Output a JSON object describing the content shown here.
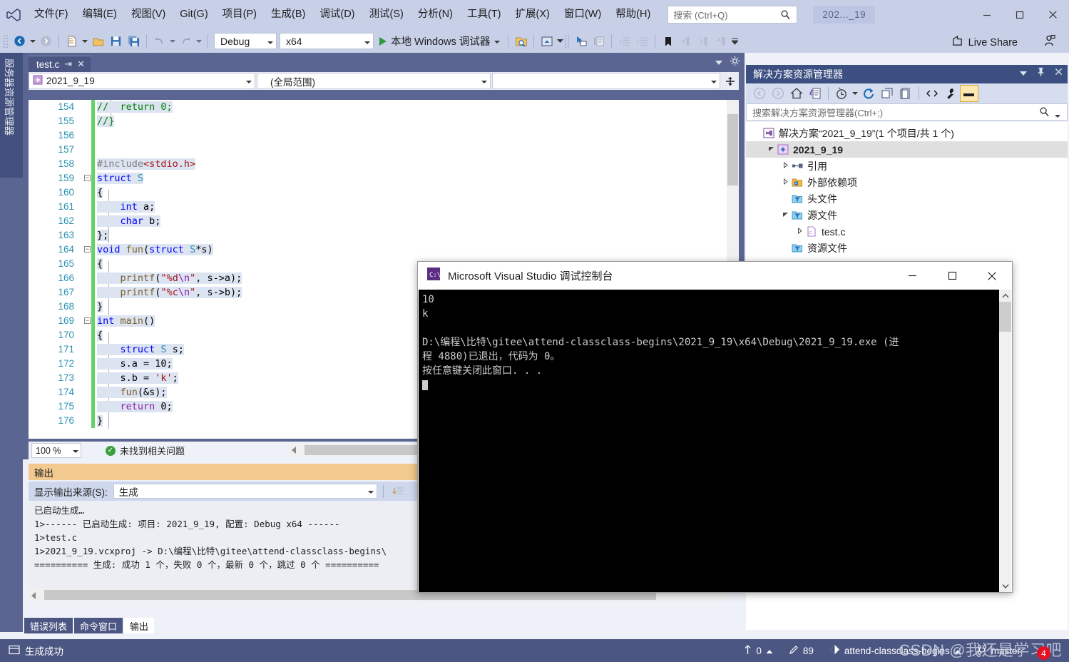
{
  "titlebar": {
    "menus": [
      "文件(F)",
      "编辑(E)",
      "视图(V)",
      "Git(G)",
      "项目(P)",
      "生成(B)",
      "调试(D)",
      "测试(S)",
      "分析(N)",
      "工具(T)",
      "扩展(X)",
      "窗口(W)",
      "帮助(H)"
    ],
    "search_placeholder": "搜索 (Ctrl+Q)",
    "window_title": "202..._19"
  },
  "toolbar": {
    "configuration": "Debug",
    "platform": "x64",
    "run_label": "本地 Windows 调试器",
    "live_share": "Live Share"
  },
  "left_sidebar": {
    "tab_label": "服务器资源管理器"
  },
  "editor": {
    "tab_name": "test.c",
    "nav_project": "2021_9_19",
    "nav_scope": "(全局范围)",
    "nav_member": "",
    "zoom": "100 %",
    "status_message": "未找到相关问题",
    "first_line_number": 154,
    "lines": [
      {
        "n": 154,
        "indent": 0,
        "tokens": [
          {
            "t": "//  return 0;",
            "c": "k-green"
          }
        ]
      },
      {
        "n": 155,
        "indent": 0,
        "tokens": [
          {
            "t": "//}",
            "c": "k-green"
          }
        ]
      },
      {
        "n": 156,
        "indent": 0,
        "tokens": []
      },
      {
        "n": 157,
        "indent": 0,
        "tokens": []
      },
      {
        "n": 158,
        "indent": 0,
        "tokens": [
          {
            "t": "#include",
            "c": "k-gray"
          },
          {
            "t": "<stdio.h>",
            "c": "k-red"
          }
        ]
      },
      {
        "n": 159,
        "indent": 0,
        "fold": true,
        "tokens": [
          {
            "t": "struct ",
            "c": "k-blue"
          },
          {
            "t": "S",
            "c": "k-teal"
          }
        ]
      },
      {
        "n": 160,
        "indent": 0,
        "tokens": [
          {
            "t": "{",
            "c": "k-blk"
          }
        ]
      },
      {
        "n": 161,
        "indent": 0,
        "tokens": [
          {
            "t": "    ",
            "c": "k-blk"
          },
          {
            "t": "int",
            "c": "k-blue"
          },
          {
            "t": " a;",
            "c": "k-blk"
          }
        ]
      },
      {
        "n": 162,
        "indent": 0,
        "tokens": [
          {
            "t": "    ",
            "c": "k-blk"
          },
          {
            "t": "char",
            "c": "k-blue"
          },
          {
            "t": " b;",
            "c": "k-blk"
          }
        ]
      },
      {
        "n": 163,
        "indent": 0,
        "tokens": [
          {
            "t": "};",
            "c": "k-blk"
          }
        ]
      },
      {
        "n": 164,
        "indent": 0,
        "fold": true,
        "tokens": [
          {
            "t": "void ",
            "c": "k-blue"
          },
          {
            "t": "fun",
            "c": "k-brown"
          },
          {
            "t": "(",
            "c": "k-blk"
          },
          {
            "t": "struct ",
            "c": "k-blue"
          },
          {
            "t": "S",
            "c": "k-teal"
          },
          {
            "t": "*s)",
            "c": "k-blk"
          }
        ]
      },
      {
        "n": 165,
        "indent": 0,
        "tokens": [
          {
            "t": "{",
            "c": "k-blk"
          }
        ]
      },
      {
        "n": 166,
        "indent": 0,
        "tokens": [
          {
            "t": "    ",
            "c": "k-blk"
          },
          {
            "t": "printf",
            "c": "k-brown"
          },
          {
            "t": "(",
            "c": "k-blk"
          },
          {
            "t": "\"%d",
            "c": "k-red"
          },
          {
            "t": "\\n",
            "c": "k-pur"
          },
          {
            "t": "\"",
            "c": "k-red"
          },
          {
            "t": ", s->a);",
            "c": "k-blk"
          }
        ]
      },
      {
        "n": 167,
        "indent": 0,
        "tokens": [
          {
            "t": "    ",
            "c": "k-blk"
          },
          {
            "t": "printf",
            "c": "k-brown"
          },
          {
            "t": "(",
            "c": "k-blk"
          },
          {
            "t": "\"%c",
            "c": "k-red"
          },
          {
            "t": "\\n",
            "c": "k-pur"
          },
          {
            "t": "\"",
            "c": "k-red"
          },
          {
            "t": ", s->b);",
            "c": "k-blk"
          }
        ]
      },
      {
        "n": 168,
        "indent": 0,
        "tokens": [
          {
            "t": "}",
            "c": "k-blk"
          }
        ]
      },
      {
        "n": 169,
        "indent": 0,
        "fold": true,
        "tokens": [
          {
            "t": "int ",
            "c": "k-blue"
          },
          {
            "t": "main",
            "c": "k-brown"
          },
          {
            "t": "()",
            "c": "k-blk"
          }
        ]
      },
      {
        "n": 170,
        "indent": 0,
        "tokens": [
          {
            "t": "{",
            "c": "k-blk"
          }
        ]
      },
      {
        "n": 171,
        "indent": 0,
        "tokens": [
          {
            "t": "    ",
            "c": "k-blk"
          },
          {
            "t": "struct ",
            "c": "k-blue"
          },
          {
            "t": "S",
            "c": "k-teal"
          },
          {
            "t": " s;",
            "c": "k-blk"
          }
        ]
      },
      {
        "n": 172,
        "indent": 0,
        "tokens": [
          {
            "t": "    s.a = 10;",
            "c": "k-blk"
          }
        ]
      },
      {
        "n": 173,
        "indent": 0,
        "tokens": [
          {
            "t": "    s.b = ",
            "c": "k-blk"
          },
          {
            "t": "'k'",
            "c": "k-red"
          },
          {
            "t": ";",
            "c": "k-blk"
          }
        ]
      },
      {
        "n": 174,
        "indent": 0,
        "tokens": [
          {
            "t": "    ",
            "c": "k-blk"
          },
          {
            "t": "fun",
            "c": "k-brown"
          },
          {
            "t": "(&s);",
            "c": "k-blk"
          }
        ]
      },
      {
        "n": 175,
        "indent": 0,
        "tokens": [
          {
            "t": "    ",
            "c": "k-blk"
          },
          {
            "t": "return",
            "c": "k-pur"
          },
          {
            "t": " 0;",
            "c": "k-blk"
          }
        ]
      },
      {
        "n": 176,
        "indent": 0,
        "tokens": [
          {
            "t": "}",
            "c": "k-blk"
          }
        ]
      }
    ]
  },
  "output": {
    "panel_title": "输出",
    "source_label": "显示输出来源(S):",
    "source_value": "生成",
    "lines": [
      "已启动生成…",
      "1>------ 已启动生成: 项目: 2021_9_19, 配置: Debug x64 ------",
      "1>test.c",
      "1>2021_9_19.vcxproj -> D:\\编程\\比特\\gitee\\attend-classclass-begins\\",
      "========== 生成: 成功 1 个，失败 0 个，最新 0 个，跳过 0 个 =========="
    ],
    "tabs": [
      {
        "label": "错误列表",
        "active": false
      },
      {
        "label": "命令窗口",
        "active": false
      },
      {
        "label": "输出",
        "active": true
      }
    ]
  },
  "solution_explorer": {
    "title": "解决方案资源管理器",
    "search_placeholder": "搜索解决方案资源管理器(Ctrl+;)",
    "tree": [
      {
        "label": "解决方案“2021_9_19”(1 个项目/共 1 个)",
        "depth": 0,
        "arrow": "",
        "icon": "solution-icon",
        "bold": false,
        "selected": false
      },
      {
        "label": "2021_9_19",
        "depth": 1,
        "arrow": "expanded",
        "icon": "project-icon",
        "bold": true,
        "selected": true
      },
      {
        "label": "引用",
        "depth": 2,
        "arrow": "collapsed",
        "icon": "references-icon",
        "bold": false,
        "selected": false
      },
      {
        "label": "外部依赖项",
        "depth": 2,
        "arrow": "collapsed",
        "icon": "folder-dep-icon",
        "bold": false,
        "selected": false
      },
      {
        "label": "头文件",
        "depth": 2,
        "arrow": "",
        "icon": "filter-folder-icon",
        "bold": false,
        "selected": false
      },
      {
        "label": "源文件",
        "depth": 2,
        "arrow": "expanded",
        "icon": "filter-folder-icon",
        "bold": false,
        "selected": false
      },
      {
        "label": "test.c",
        "depth": 3,
        "arrow": "collapsed",
        "icon": "c-file-icon",
        "bold": false,
        "selected": false
      },
      {
        "label": "资源文件",
        "depth": 2,
        "arrow": "",
        "icon": "filter-folder-icon",
        "bold": false,
        "selected": false
      }
    ]
  },
  "console": {
    "title": "Microsoft Visual Studio 调试控制台",
    "lines": [
      "10",
      "k",
      "",
      "D:\\编程\\比特\\gitee\\attend-classclass-begins\\2021_9_19\\x64\\Debug\\2021_9_19.exe (进",
      "程 4880)已退出，代码为 0。",
      "按任意键关闭此窗口. . ."
    ]
  },
  "statusbar": {
    "build_status": "生成成功",
    "pending_changes": "0",
    "edit_count": "89",
    "repo": "attend-classclass-begins",
    "branch": "master",
    "notification_count": "4",
    "watermark": "CSDN @我还是学习吧"
  },
  "colors": {
    "chrome": "#c8d0e8",
    "accent_blue": "#3b4f81",
    "status_bar": "#4b5682",
    "output_header": "#f2c98e",
    "change_bar_green": "#63d363",
    "selection": "#dce3f1"
  }
}
